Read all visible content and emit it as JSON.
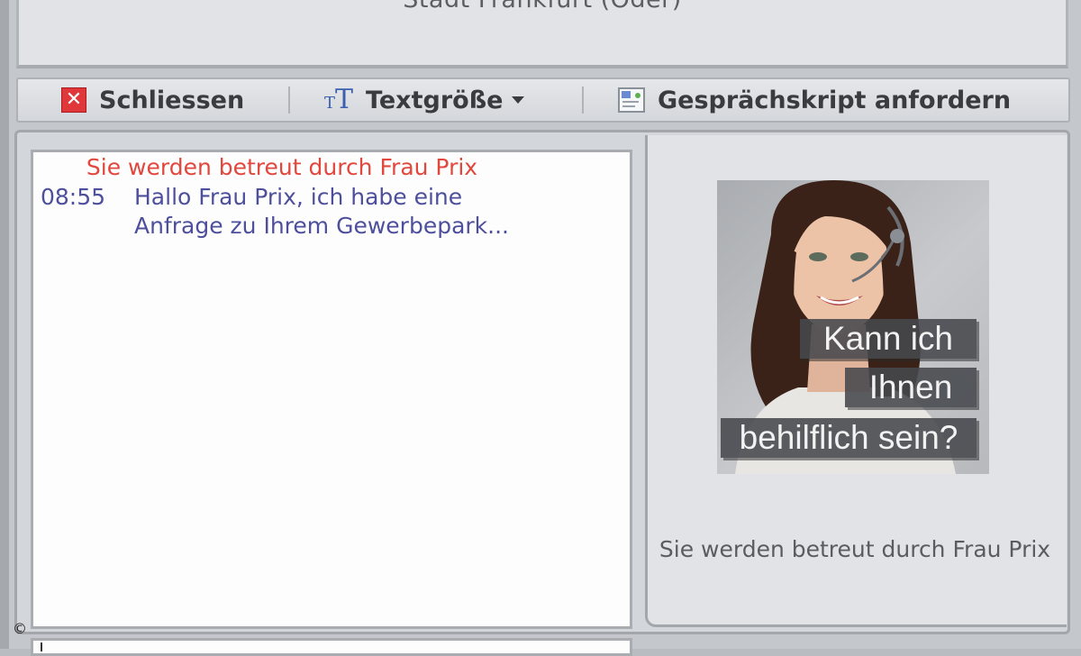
{
  "window": {
    "title": "Stadt Frankfurt (Oder)"
  },
  "toolbar": {
    "close_label": "Schliessen",
    "close_icon": "close-icon",
    "textsize_label": "Textgröße",
    "textsize_icon": "text-size-icon",
    "script_label": "Gesprächskript anfordern",
    "script_icon": "document-icon"
  },
  "chat": {
    "header": "Sie werden betreut durch Frau Prix",
    "header_color": "#e2473d",
    "messages": [
      {
        "time": "08:55",
        "text": "Hallo Frau Prix, ich habe eine Anfrage zu Ihrem Gewerbepark...",
        "color": "#4e4f9c"
      }
    ]
  },
  "agent": {
    "overlay_lines": [
      "Kann ich",
      "Ihnen",
      "behilflich sein?"
    ],
    "caption": "Sie werden betreut durch Frau Prix"
  },
  "footer": {
    "copyright": "©"
  }
}
